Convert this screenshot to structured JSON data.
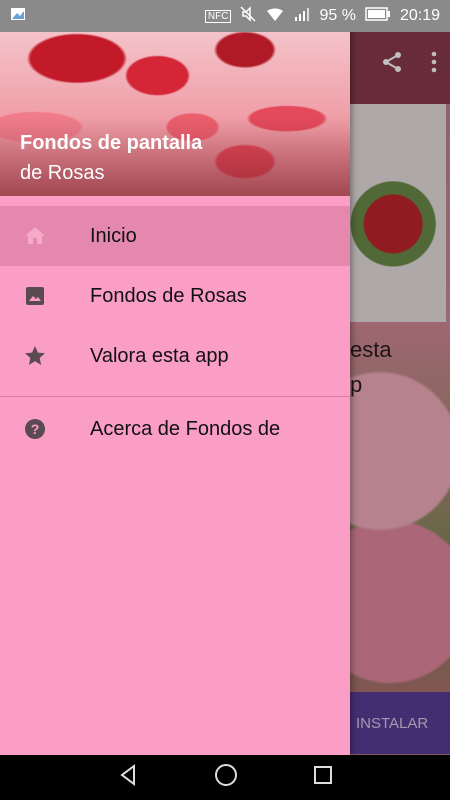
{
  "status_bar": {
    "battery_percent": "95 %",
    "time": "20:19",
    "nfc_label": "NFC"
  },
  "background_app": {
    "text_line1": "esta",
    "text_line2": "p",
    "install_button": "INSTALAR"
  },
  "drawer": {
    "header_title": "Fondos de pantalla",
    "header_subtitle": "de Rosas",
    "items": [
      {
        "label": "Inicio",
        "icon": "home-icon",
        "active": true
      },
      {
        "label": "Fondos de Rosas",
        "icon": "image-icon",
        "active": false
      },
      {
        "label": "Valora esta app",
        "icon": "star-icon",
        "active": false
      },
      {
        "label": "Acerca de Fondos de",
        "icon": "help-icon",
        "active": false
      }
    ]
  },
  "colors": {
    "drawer_bg": "#fb9ec6",
    "active_item_bg": "#e489ad",
    "toolbar_bg": "#8a3b4a",
    "install_bg": "#5d3c99"
  }
}
